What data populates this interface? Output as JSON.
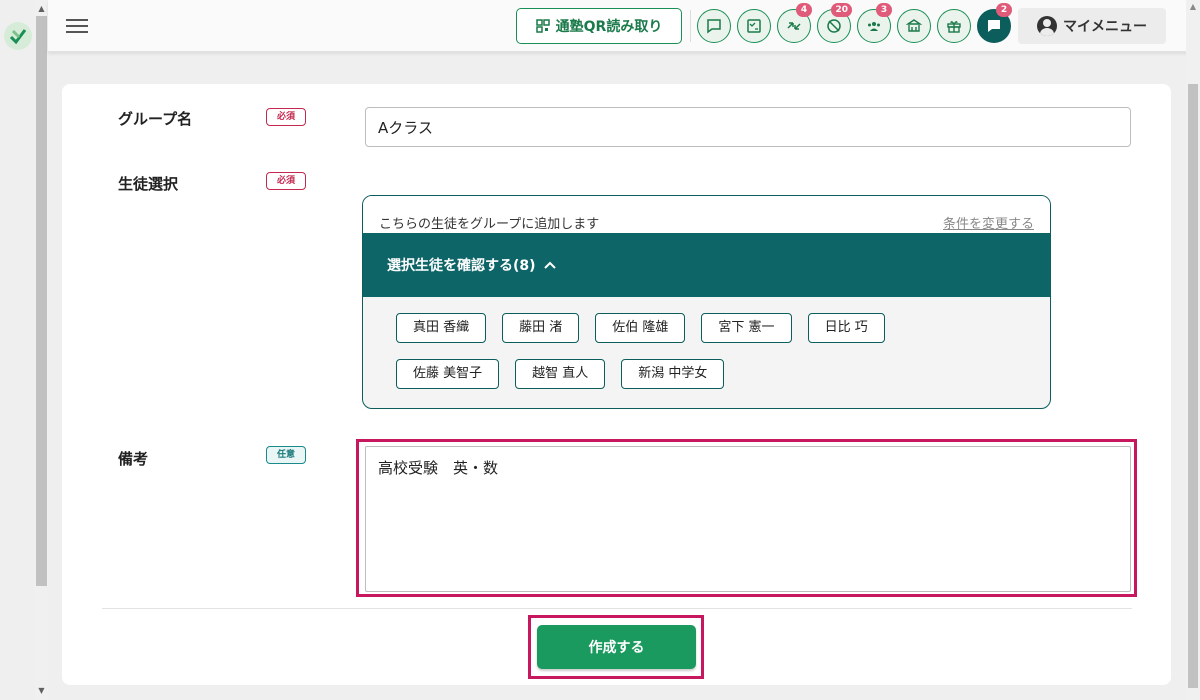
{
  "header": {
    "qr_button_label": "通塾QR読み取り",
    "badges": {
      "transfer": "4",
      "attendance": "20",
      "group": "3",
      "message": "2"
    },
    "my_menu_label": "マイメニュー"
  },
  "form": {
    "group_name": {
      "label": "グループ名",
      "required_badge": "必須",
      "value": "Aクラス"
    },
    "student_select": {
      "label": "生徒選択",
      "required_badge": "必須",
      "description": "こちらの生徒をグループに追加します",
      "change_link": "条件を変更する",
      "toggle_label": "選択生徒を確認する(8)",
      "students": [
        "真田 香織",
        "藤田 渚",
        "佐伯 隆雄",
        "宮下 憲一",
        "日比 巧",
        "佐藤 美智子",
        "越智 直人",
        "新潟 中学女"
      ]
    },
    "memo": {
      "label": "備考",
      "optional_badge": "任意",
      "value": "高校受験　英・数"
    },
    "submit_label": "作成する"
  },
  "colors": {
    "primary_green": "#1a9a5e",
    "teal": "#0d6568",
    "highlight": "#c7175f",
    "required": "#c4284e"
  }
}
